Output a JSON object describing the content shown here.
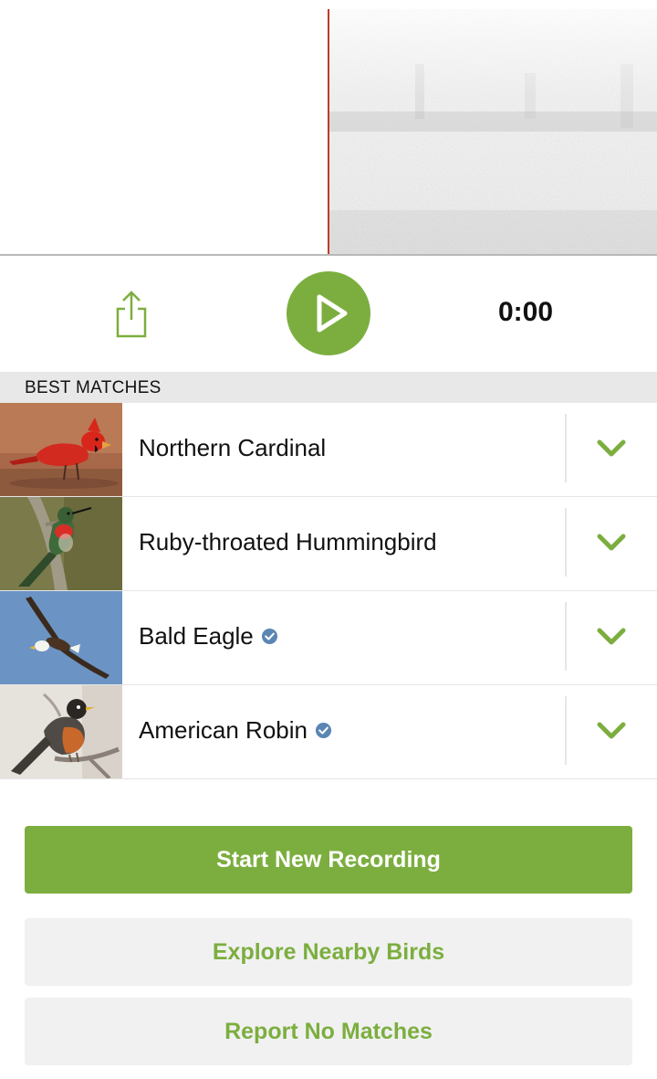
{
  "colors": {
    "accent": "#7cae3f",
    "verified_badge": "#5a86b4",
    "playhead": "#c0392b",
    "section_header_bg": "#e8e8e8",
    "secondary_button_bg": "#f1f1f1"
  },
  "spectrogram": {
    "icon": "spectrogram-waveform"
  },
  "player": {
    "share_icon": "share-icon",
    "play_icon": "play-icon",
    "time": "0:00"
  },
  "matches": {
    "header": "BEST MATCHES",
    "expand_icon": "chevron-down-icon",
    "verified_icon": "verified-check-icon",
    "items": [
      {
        "name": "Northern Cardinal",
        "verified": false,
        "photo": "northern-cardinal-photo"
      },
      {
        "name": "Ruby-throated Hummingbird",
        "verified": false,
        "photo": "ruby-throated-hummingbird-photo"
      },
      {
        "name": "Bald Eagle",
        "verified": true,
        "photo": "bald-eagle-photo"
      },
      {
        "name": "American Robin",
        "verified": true,
        "photo": "american-robin-photo"
      }
    ]
  },
  "actions": {
    "start_new_recording": "Start New Recording",
    "explore_nearby_birds": "Explore Nearby Birds",
    "report_no_matches": "Report No Matches"
  }
}
